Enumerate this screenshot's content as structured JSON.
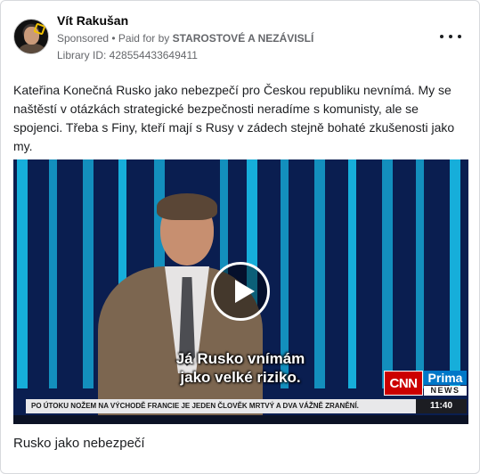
{
  "post": {
    "author_name": "Vít Rakušan",
    "sponsored_label": "Sponsored",
    "paid_for_prefix": " • Paid for by ",
    "paid_for_by": "STAROSTOVÉ A NEZÁVISLÍ",
    "library_id": "Library ID: 428554433649411",
    "more_icon": "more-horizontal-icon",
    "body": "Kateřina Konečná Rusko jako nebezpečí pro Českou republiku nevnímá. My se naštěstí v otázkách strategické bezpečnosti neradíme s komunisty, ale se spojenci. Třeba s Finy, kteří mají s Rusy v zádech stejně bohaté zkušenosti jako my."
  },
  "video": {
    "subtitle_line1": "Já Rusko vnímám",
    "subtitle_line2": "jako velké riziko.",
    "logo_cnn": "CNN",
    "logo_prima": "Prima",
    "logo_news": "NEWS",
    "ticker": "PO ÚTOKU NOŽEM NA VÝCHODĚ FRANCIE JE JEDEN ČLOVĚK MRTVÝ A DVA VÁŽNĚ ZRANĚNÍ.",
    "clock": "11:40",
    "play_icon": "play-icon"
  },
  "caption": "Rusko jako nebezpečí",
  "colors": {
    "stripe_cyan": "#17b6e2",
    "stripe_navy": "#0a1e50",
    "cnn_red": "#cc0000",
    "prima_blue": "#0077c8"
  }
}
